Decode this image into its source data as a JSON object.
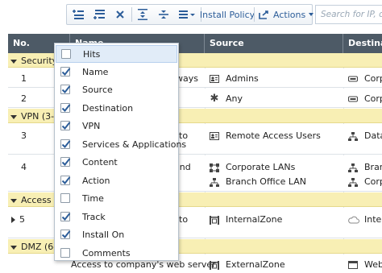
{
  "toolbar": {
    "install_policy_label": "Install Policy",
    "actions_label": "Actions",
    "search_placeholder": "Search for IP, ob"
  },
  "table": {
    "columns": [
      "No.",
      "Name",
      "Source",
      "Destination"
    ],
    "sections": {
      "security": "Security C",
      "vpn": "VPN (3-4",
      "access": "Access To",
      "dmz": "DMZ (6-"
    },
    "rows": [
      {
        "no": "1",
        "name": "ways",
        "source": [
          "Admins"
        ],
        "destination": [
          "Corpo"
        ]
      },
      {
        "no": "2",
        "name": "",
        "source": [
          "Any"
        ],
        "destination": [
          "Corpo"
        ]
      },
      {
        "no": "3",
        "name": "to",
        "source": [
          "Remote Access Users"
        ],
        "destination": [
          "Datac"
        ]
      },
      {
        "no": "4",
        "name": "and",
        "source": [
          "Corporate LANs",
          "Branch Office LAN"
        ],
        "destination": [
          "Bran",
          "Corpo"
        ]
      },
      {
        "no": "5",
        "name": "to",
        "source": [
          "InternalZone"
        ],
        "destination": [
          "Intern"
        ]
      },
      {
        "no": "",
        "name": "Access to company's web server",
        "source": [
          "ExternalZone"
        ],
        "destination": [
          "Web"
        ]
      }
    ]
  },
  "column_menu": {
    "items": [
      {
        "label": "Hits",
        "checked": false
      },
      {
        "label": "Name",
        "checked": true
      },
      {
        "label": "Source",
        "checked": true
      },
      {
        "label": "Destination",
        "checked": true
      },
      {
        "label": "VPN",
        "checked": true
      },
      {
        "label": "Services & Applications",
        "checked": true
      },
      {
        "label": "Content",
        "checked": true
      },
      {
        "label": "Action",
        "checked": true
      },
      {
        "label": "Time",
        "checked": false
      },
      {
        "label": "Track",
        "checked": true
      },
      {
        "label": "Install On",
        "checked": true
      },
      {
        "label": "Comments",
        "checked": false
      }
    ]
  },
  "colors": {
    "header_bg": "#4d5a66",
    "section_bg": "#f8efb4",
    "accent": "#2c5d99",
    "menu_highlight": "#e1ecf8"
  }
}
